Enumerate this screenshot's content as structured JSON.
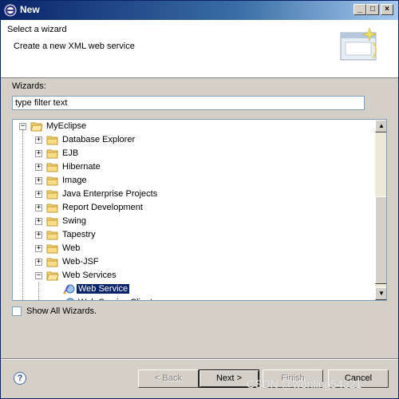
{
  "window": {
    "title": "New"
  },
  "header": {
    "title": "Select a wizard",
    "description": "Create a new XML web service"
  },
  "wizards_label": "Wizards:",
  "filter": {
    "value": "type filter text"
  },
  "tree": {
    "root": "MyEclipse",
    "items": [
      "Database Explorer",
      "EJB",
      "Hibernate",
      "Image",
      "Java Enterprise Projects",
      "Report Development",
      "Swing",
      "Tapestry",
      "Web",
      "Web-JSF",
      "Web Services"
    ],
    "child_selected": "Web Service",
    "child_partial": "Web Service Client"
  },
  "show_all_label": "Show All Wizards.",
  "buttons": {
    "back": "< Back",
    "next": "Next >",
    "finish": "Finish",
    "cancel": "Cancel"
  },
  "watermark": "CSDN @wonling54321"
}
